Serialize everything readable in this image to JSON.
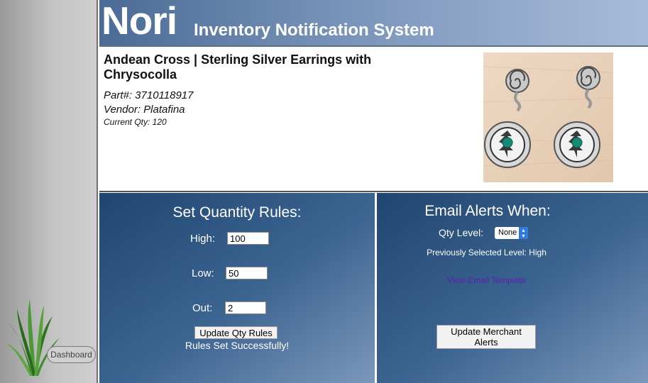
{
  "header": {
    "logo": "Nori",
    "subtitle": "Inventory Notification System"
  },
  "sidebar": {
    "dashboard_label": "Dashboard"
  },
  "product": {
    "title": "Andean Cross | Sterling Silver Earrings with Chrysocolla",
    "part": "Part#: 3710118917",
    "vendor": "Vendor: Platafina",
    "current_qty": "Current Qty: 120"
  },
  "rules": {
    "title": "Set Quantity Rules:",
    "high_label": "High:",
    "high_value": "100",
    "low_label": "Low:",
    "low_value": "50",
    "out_label": "Out:",
    "out_value": "2",
    "update_button": "Update Qty Rules",
    "status": "Rules Set Successfully!"
  },
  "alerts": {
    "title": "Email Alerts When:",
    "qty_level_label": "Qty Level:",
    "qty_level_selected": "None",
    "previous": "Previously Selected Level: High",
    "template_link": "View Email Template",
    "update_button": "Update Merchant Alerts"
  },
  "colors": {
    "panel": "#3d6592",
    "header": "#7e98bd",
    "link": "#5a1fb0",
    "grass": "#3f8a2c"
  }
}
